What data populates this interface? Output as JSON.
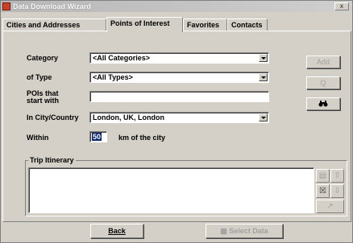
{
  "window": {
    "title": "Data Download Wizard",
    "close_glyph": "x"
  },
  "tabs": [
    {
      "label": "Cities and Addresses",
      "active": false
    },
    {
      "label": "Points of Interest",
      "active": true
    },
    {
      "label": "Favorites",
      "active": false
    },
    {
      "label": "Contacts",
      "active": false
    }
  ],
  "form": {
    "category_label": "Category",
    "category_value": "<All Categories>",
    "type_label": "of Type",
    "type_value": "<All Types>",
    "poi_start_label_line1": "POIs that",
    "poi_start_label_line2": "start with",
    "poi_start_value": "",
    "city_label": "In City/Country",
    "city_value": "London, UK, London",
    "within_label": "Within",
    "within_value": "50",
    "within_unit": "km of the city"
  },
  "side_buttons": {
    "add_label": "Add",
    "zoom_label": "Q",
    "find_label": "Find"
  },
  "itinerary": {
    "title": "Trip Itinerary",
    "items": []
  },
  "bottom": {
    "back_label": "Back",
    "select_label": "Select Data"
  },
  "colors": {
    "face": "#d4d0c8",
    "selection": "#0a246a",
    "app_icon": "#c8402a"
  }
}
